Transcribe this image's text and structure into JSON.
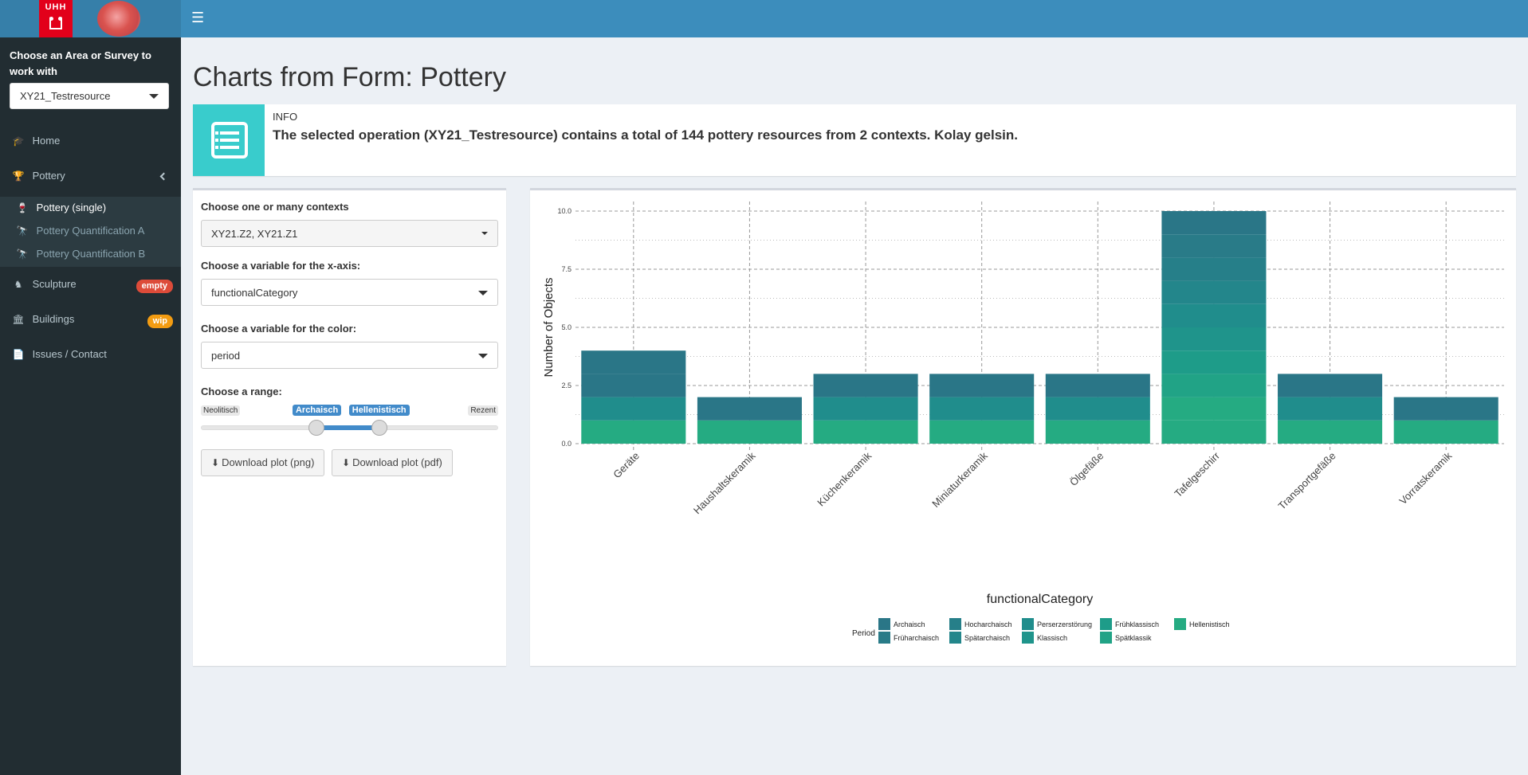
{
  "header": {
    "logo_left_text": "UHH",
    "menu_icon": "hamburger-icon"
  },
  "sidebar": {
    "title": "Choose an Area or Survey to work with",
    "survey_select": "XY21_Testresource",
    "items": [
      {
        "label": "Home",
        "icon": "graduation-cap-icon"
      },
      {
        "label": "Pottery",
        "icon": "trophy-icon"
      },
      {
        "label": "Sculpture",
        "icon": "horse-head-icon",
        "badge": "empty"
      },
      {
        "label": "Buildings",
        "icon": "building-icon",
        "badge": "wip"
      },
      {
        "label": "Issues / Contact",
        "icon": "file-text-icon"
      }
    ],
    "pottery_sub": [
      {
        "label": "Pottery (single)",
        "icon": "wine-glass-icon"
      },
      {
        "label": "Pottery Quantification A",
        "icon": "binoculars-icon"
      },
      {
        "label": "Pottery Quantification B",
        "icon": "binoculars-icon"
      }
    ]
  },
  "main": {
    "title": "Charts from Form: Pottery",
    "info_label": "INFO",
    "info_text": "The selected operation (XY21_Testresource) contains a total of 144 pottery resources from 2 contexts. Kolay gelsin.",
    "controls": {
      "contexts_label": "Choose one or many contexts",
      "contexts_value": "XY21.Z2, XY21.Z1",
      "x_label": "Choose a variable for the x-axis:",
      "x_value": "functionalCategory",
      "color_label": "Choose a variable for the color:",
      "color_value": "period",
      "range_label": "Choose a range:",
      "range_min": "Neolitisch",
      "range_max": "Rezent",
      "range_from": "Archaisch",
      "range_to": "Hellenistisch",
      "range_from_fraction": 0.39,
      "range_to_fraction": 0.6,
      "download_png": "Download plot (png)",
      "download_pdf": "Download plot (pdf)"
    }
  },
  "chart_data": {
    "type": "bar",
    "stacked": true,
    "xlabel": "functionalCategory",
    "ylabel": "Number of Objects",
    "ylim": [
      0,
      10
    ],
    "yticks": [
      "0.0",
      "2.5",
      "5.0",
      "7.5",
      "10.0"
    ],
    "categories": [
      "Geräte",
      "Haushaltskeramik",
      "Küchenkeramik",
      "Miniaturkeramik",
      "Ölgefäße",
      "Tafelgeschirr",
      "Transportgefäße",
      "Vorratskeramik"
    ],
    "totals": [
      4,
      2,
      3,
      3,
      3,
      10,
      3,
      2
    ],
    "segments": [
      [
        {
          "period": "Archaisch",
          "value": 2
        },
        {
          "period": "Perserzerstörung",
          "value": 1
        },
        {
          "period": "Hellenistisch",
          "value": 1
        }
      ],
      [
        {
          "period": "Archaisch",
          "value": 1
        },
        {
          "period": "Hellenistisch",
          "value": 1
        }
      ],
      [
        {
          "period": "Archaisch",
          "value": 1
        },
        {
          "period": "Perserzerstörung",
          "value": 1
        },
        {
          "period": "Hellenistisch",
          "value": 1
        }
      ],
      [
        {
          "period": "Archaisch",
          "value": 1
        },
        {
          "period": "Perserzerstörung",
          "value": 1
        },
        {
          "period": "Hellenistisch",
          "value": 1
        }
      ],
      [
        {
          "period": "Archaisch",
          "value": 1
        },
        {
          "period": "Perserzerstörung",
          "value": 1
        },
        {
          "period": "Hellenistisch",
          "value": 1
        }
      ],
      [
        {
          "period": "Archaisch",
          "value": 1
        },
        {
          "period": "Früharchaisch",
          "value": 1
        },
        {
          "period": "Hocharchaisch",
          "value": 1
        },
        {
          "period": "Spätarchaisch",
          "value": 1
        },
        {
          "period": "Perserzerstörung",
          "value": 1
        },
        {
          "period": "Klassisch",
          "value": 1
        },
        {
          "period": "Frühklassisch",
          "value": 1
        },
        {
          "period": "Spätklassik",
          "value": 1
        },
        {
          "period": "Hellenistisch",
          "value": 2
        }
      ],
      [
        {
          "period": "Archaisch",
          "value": 1
        },
        {
          "period": "Perserzerstörung",
          "value": 1
        },
        {
          "period": "Hellenistisch",
          "value": 1
        }
      ],
      [
        {
          "period": "Archaisch",
          "value": 1
        },
        {
          "period": "Hellenistisch",
          "value": 1
        }
      ]
    ],
    "legend_title": "Period",
    "legend_position": "bottom",
    "legend": [
      {
        "name": "Archaisch",
        "color": "#2a7687"
      },
      {
        "name": "Früharchaisch",
        "color": "#297b88"
      },
      {
        "name": "Hocharchaisch",
        "color": "#267f89"
      },
      {
        "name": "Spätarchaisch",
        "color": "#23868b"
      },
      {
        "name": "Perserzerstörung",
        "color": "#208d8c"
      },
      {
        "name": "Klassisch",
        "color": "#1f948b"
      },
      {
        "name": "Frühklassisch",
        "color": "#1e9c89"
      },
      {
        "name": "Spätklassik",
        "color": "#21a386"
      },
      {
        "name": "Hellenistisch",
        "color": "#25ab82"
      }
    ]
  }
}
